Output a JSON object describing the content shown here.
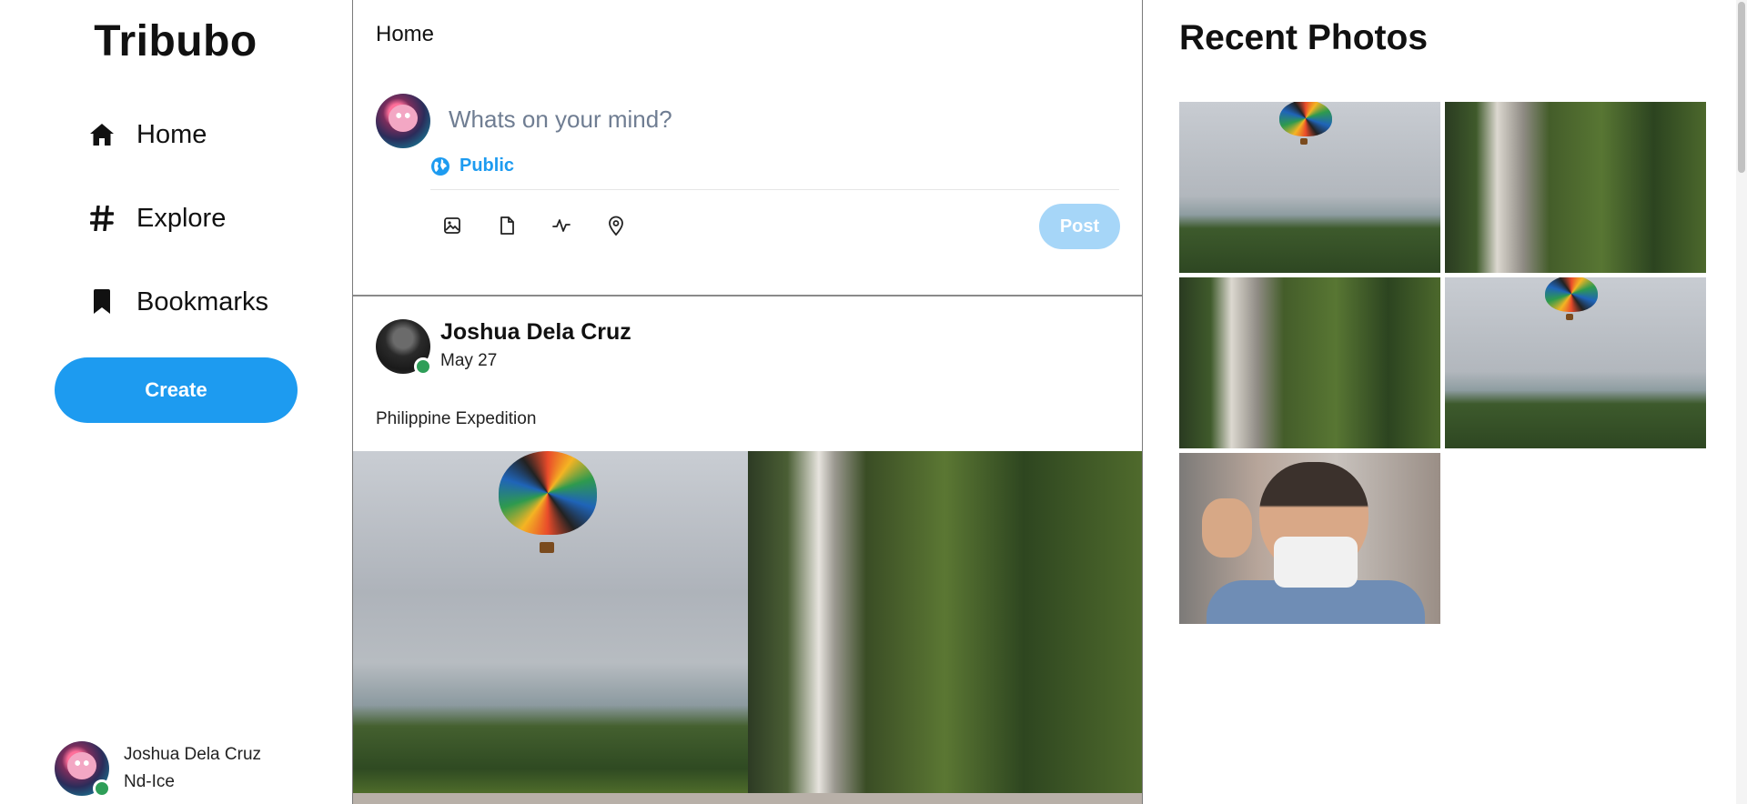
{
  "app": {
    "name": "Tribubo"
  },
  "sidebar": {
    "items": [
      {
        "label": "Home",
        "icon": "home-icon"
      },
      {
        "label": "Explore",
        "icon": "hash-icon"
      },
      {
        "label": "Bookmarks",
        "icon": "bookmark-icon"
      }
    ],
    "create_label": "Create",
    "profile": {
      "name": "Joshua Dela Cruz",
      "handle": "Nd-Ice",
      "status": "online",
      "status_color": "#2e9e58"
    }
  },
  "feed": {
    "title": "Home",
    "composer": {
      "placeholder": "Whats on your mind?",
      "audience": "Public",
      "post_label": "Post",
      "tools": [
        "image-icon",
        "file-icon",
        "activity-icon",
        "location-icon"
      ]
    },
    "post": {
      "author": "Joshua Dela Cruz",
      "date": "May 27",
      "text": "Philippine Expedition",
      "photos": [
        "hot-air-balloon-landscape",
        "waterfall-cliff"
      ]
    }
  },
  "right_panel": {
    "title": "Recent Photos",
    "photos": [
      "hot-air-balloon-landscape",
      "waterfall-cliff",
      "waterfall-cliff",
      "hot-air-balloon-landscape",
      "person-with-mask"
    ]
  },
  "colors": {
    "accent": "#1d9bf0",
    "post_disabled": "#a6d6f8",
    "online": "#2e9e58"
  }
}
